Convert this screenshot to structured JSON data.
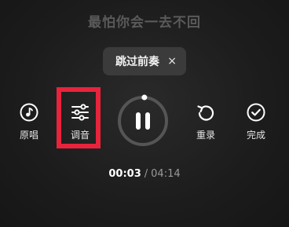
{
  "lyric": "最怕你会一去不回",
  "skip_intro": {
    "label": "跳过前奏",
    "close_symbol": "×"
  },
  "controls": {
    "original": {
      "label": "原唱",
      "icon": "music-note-icon"
    },
    "tune": {
      "label": "调音",
      "icon": "sliders-icon"
    },
    "play": {
      "icon": "pause-icon",
      "progress": 0.01
    },
    "rerecord": {
      "label": "重录",
      "icon": "redo-icon"
    },
    "finish": {
      "label": "完成",
      "icon": "check-circle-icon"
    }
  },
  "time": {
    "current": "00:03",
    "separator": "/",
    "total": "04:14"
  },
  "colors": {
    "highlight": "#e8233c",
    "background": "#1c1c1c"
  }
}
